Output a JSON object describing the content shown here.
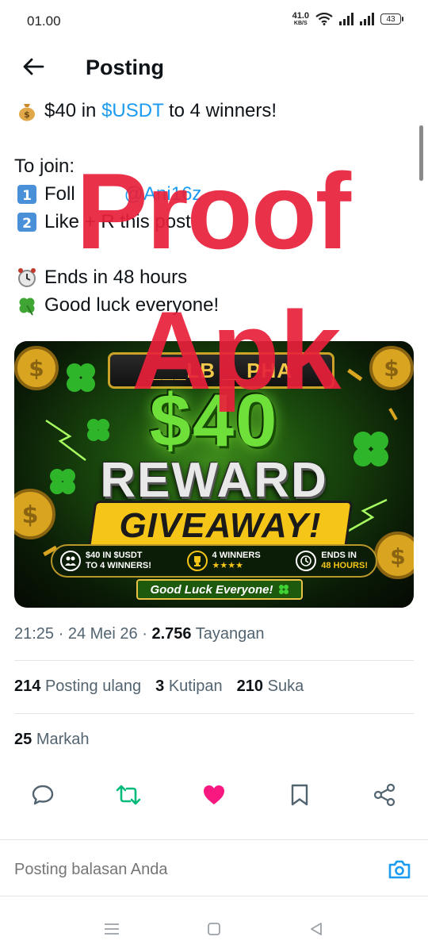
{
  "status_bar": {
    "time": "01.00",
    "net_speed": "41.0",
    "net_unit": "KB/S",
    "battery": "43"
  },
  "header": {
    "title": "Posting",
    "back_icon": "arrow-left-icon"
  },
  "post": {
    "line1_prefix": "$40 in ",
    "line1_link": "$USDT",
    "line1_suffix": " to 4 winners!",
    "join_label": "To join:",
    "step1_prefix": "Foll",
    "step1_link": "@Ani16z",
    "step2_text": "Like + R  this post",
    "ends_text": "Ends in 48 hours",
    "luck_text": "Good luck everyone!",
    "emoji_icons": [
      "money-bag-icon",
      "keycap-1-icon",
      "keycap-2-icon",
      "alarm-clock-icon",
      "four-leaf-clover-icon"
    ]
  },
  "media": {
    "brand": "___LB  __PHA",
    "amount": "$40",
    "reward": "REWARD",
    "giveaway": "GIVEAWAY!",
    "info1_line1": "$40 IN $USDT",
    "info1_line2": "TO 4 WINNERS!",
    "info2_line1": "4 WINNERS",
    "info2_line2": "★★★★",
    "info3_line1": "ENDS IN",
    "info3_line2": "48 HOURS!",
    "footer": "Good Luck Everyone!"
  },
  "watermark": {
    "line1": "Proof",
    "line2": "Apk",
    "color": "#e8203a"
  },
  "meta": {
    "time": "21:25",
    "date": "24 Mei 26",
    "views_count": "2.756",
    "views_label": "Tayangan"
  },
  "stats": {
    "reposts_count": "214",
    "reposts_label": "Posting ulang",
    "quotes_count": "3",
    "quotes_label": "Kutipan",
    "likes_count": "210",
    "likes_label": "Suka"
  },
  "bookmarks": {
    "count": "25",
    "label": "Markah"
  },
  "actions": {
    "reply_icon": "reply-bubble-icon",
    "repost_icon": "repost-icon",
    "like_icon": "heart-icon",
    "bookmark_icon": "bookmark-icon",
    "share_icon": "share-icon",
    "repost_color": "#00ba7c",
    "like_color": "#f91880"
  },
  "reply": {
    "placeholder": "Posting balasan Anda",
    "camera_icon": "camera-icon",
    "accent": "#1d9bf0"
  },
  "navbar": {
    "menu_icon": "menu-icon",
    "home_icon": "square-home-icon",
    "back_icon": "triangle-back-icon"
  }
}
